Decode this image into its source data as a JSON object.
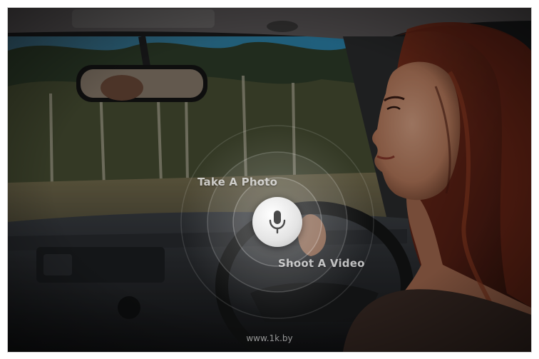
{
  "voice_control": {
    "take_photo_label": "Take A Photo",
    "shoot_video_label": "Shoot A Video",
    "mic_icon": "microphone-icon"
  },
  "watermark": {
    "text": "www.1k.by"
  }
}
